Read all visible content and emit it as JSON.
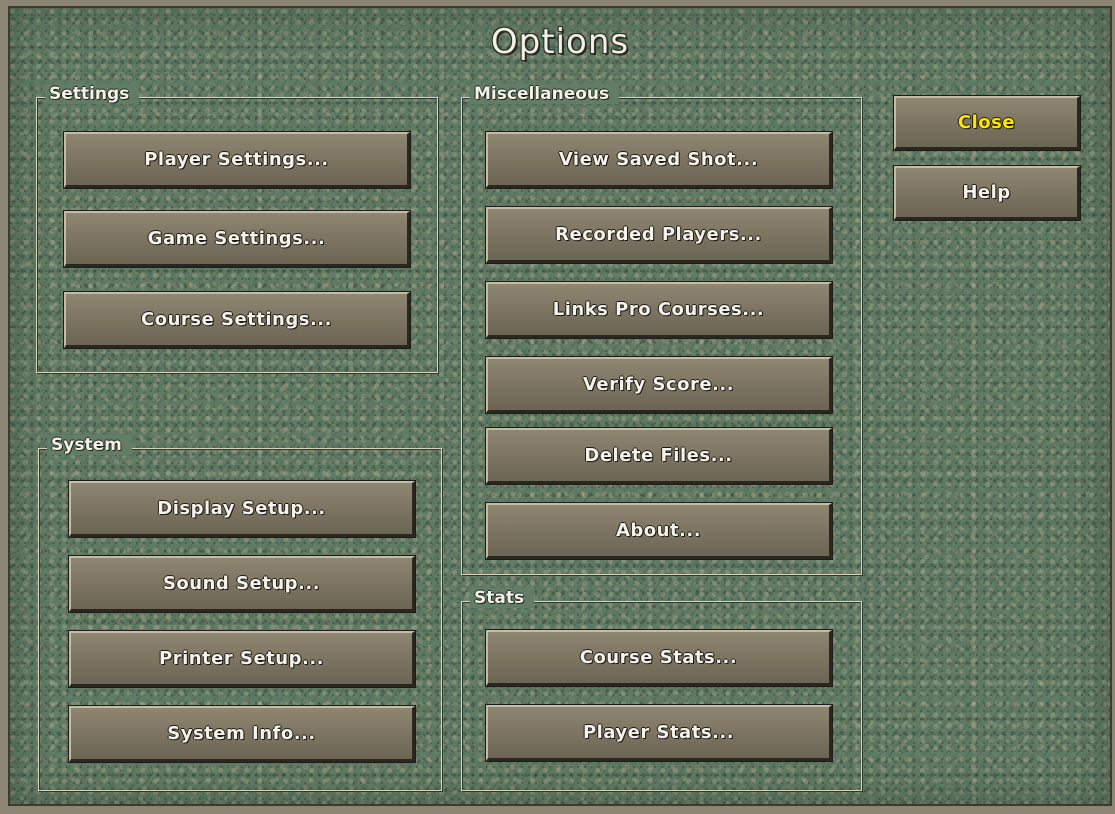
{
  "dialog": {
    "title": "Options",
    "colors": {
      "background": "#5f7a64",
      "button": "#7d7562",
      "text": "#f4f2ea",
      "close_text": "#ffe600"
    }
  },
  "settings": {
    "label": "Settings",
    "buttons": [
      "Player Settings...",
      "Game Settings...",
      "Course Settings..."
    ]
  },
  "system": {
    "label": "System",
    "buttons": [
      "Display Setup...",
      "Sound Setup...",
      "Printer Setup...",
      "System Info..."
    ]
  },
  "miscellaneous": {
    "label": "Miscellaneous",
    "buttons": [
      "View Saved Shot...",
      "Recorded Players...",
      "Links Pro Courses...",
      "Verify Score...",
      "Delete Files...",
      "About..."
    ]
  },
  "stats": {
    "label": "Stats",
    "buttons": [
      "Course Stats...",
      "Player Stats..."
    ]
  },
  "side": {
    "close_label": "Close",
    "help_label": "Help"
  }
}
